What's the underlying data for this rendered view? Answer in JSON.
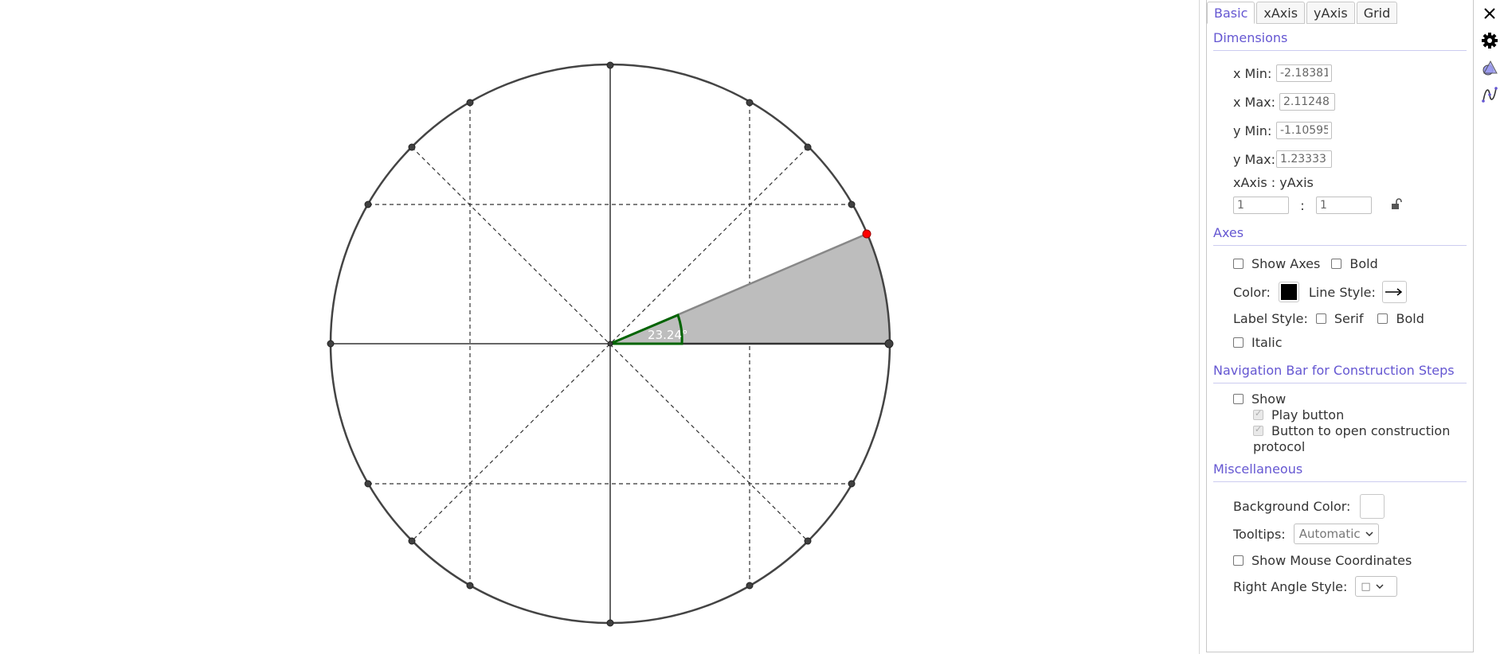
{
  "tabs": [
    "Basic",
    "xAxis",
    "yAxis",
    "Grid"
  ],
  "active_tab": "Basic",
  "dimensions": {
    "title": "Dimensions",
    "x_min_label": "x Min:",
    "x_min": "-2.18381",
    "x_max_label": "x Max:",
    "x_max": "2.11248",
    "y_min_label": "y Min:",
    "y_min": "-1.10595",
    "y_max_label": "y Max:",
    "y_max": "1.23333",
    "ratio_label": "xAxis : yAxis",
    "ratio_x": "1",
    "ratio_sep": ":",
    "ratio_y": "1"
  },
  "axes": {
    "title": "Axes",
    "show_axes": "Show Axes",
    "bold": "Bold",
    "color_label": "Color:",
    "color": "#000000",
    "line_style_label": "Line Style:",
    "label_style_label": "Label Style:",
    "serif": "Serif",
    "bold2": "Bold",
    "italic": "Italic"
  },
  "navbar": {
    "title": "Navigation Bar for Construction Steps",
    "show": "Show",
    "play_button": "Play button",
    "open_protocol": "Button to open construction",
    "open_protocol_2": "protocol"
  },
  "misc": {
    "title": "Miscellaneous",
    "background_color_label": "Background Color:",
    "background_color": "#ffffff",
    "tooltips_label": "Tooltips:",
    "tooltips_value": "Automatic",
    "mouse_coords": "Show Mouse Coordinates",
    "right_angle_label": "Right Angle Style:",
    "right_angle_value": "□"
  },
  "angle_label": "23.24°",
  "colors": {
    "accent": "#6557d2",
    "sector_fill": "#bdbdbd",
    "angle_green": "#006400",
    "point_red": "#ff0000",
    "point_dark": "#404040"
  },
  "icons": {
    "close": "close-icon",
    "settings": "gear-icon",
    "graphics": "graphics-view-icon",
    "algebra": "function-curve-icon",
    "lock": "unlocked-lock-icon",
    "arrow": "arrow-line-icon"
  }
}
